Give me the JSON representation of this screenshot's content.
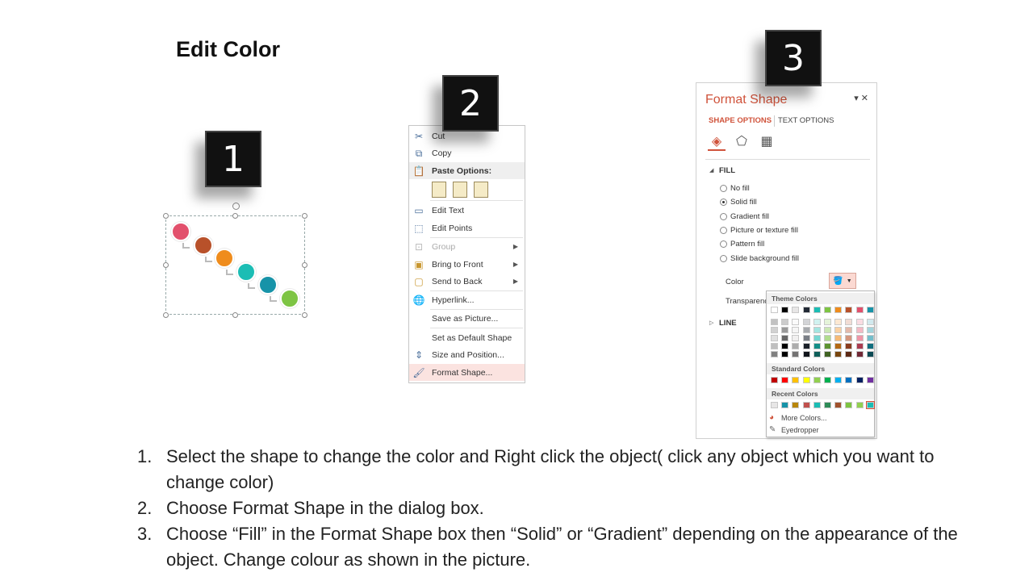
{
  "title": "Edit Color",
  "badges": [
    "1",
    "2",
    "3"
  ],
  "step1_shapes": {
    "colors": [
      "#e2506c",
      "#b8512a",
      "#ef8c1c",
      "#1bbdb4",
      "#1793a8",
      "#7dc443"
    ]
  },
  "context_menu": {
    "items": [
      {
        "label": "Cut",
        "icon": "scissors-icon"
      },
      {
        "label": "Copy",
        "icon": "copy-icon"
      },
      {
        "label": "Paste Options:",
        "icon": "paste-icon"
      },
      {
        "label": "Edit Text",
        "icon": "edit-text-icon"
      },
      {
        "label": "Edit Points",
        "icon": "edit-points-icon"
      },
      {
        "label": "Group",
        "icon": "group-icon"
      },
      {
        "label": "Bring to Front",
        "icon": "bring-front-icon"
      },
      {
        "label": "Send to Back",
        "icon": "send-back-icon"
      },
      {
        "label": "Hyperlink...",
        "icon": "hyperlink-icon"
      },
      {
        "label": "Save as Picture...",
        "icon": ""
      },
      {
        "label": "Set as Default Shape",
        "icon": ""
      },
      {
        "label": "Size and Position...",
        "icon": "size-position-icon"
      },
      {
        "label": "Format Shape...",
        "icon": "format-shape-icon"
      }
    ]
  },
  "format_pane": {
    "title": "Format Shape",
    "controls": "▾ ✕",
    "tab_shape": "SHAPE OPTIONS",
    "tab_text": "TEXT OPTIONS",
    "fill_section": "FILL",
    "fill_options": [
      "No fill",
      "Solid fill",
      "Gradient fill",
      "Picture or texture fill",
      "Pattern fill",
      "Slide background fill"
    ],
    "selected_fill": "Solid fill",
    "color_label": "Color",
    "transparency_label": "Transparenc",
    "line_section": "LINE",
    "accent_color": "#d0533b"
  },
  "palette": {
    "theme_header": "Theme Colors",
    "standard_header": "Standard Colors",
    "recent_header": "Recent Colors",
    "more_colors": "More Colors...",
    "eyedropper": "Eyedropper",
    "theme_top": [
      "#ffffff",
      "#000000",
      "#e7e6e6",
      "#222a35",
      "#1bbdb4",
      "#7dc443",
      "#ef8c1c",
      "#b8512a",
      "#e2506c",
      "#1793a8"
    ],
    "standard": [
      "#c00000",
      "#ff0000",
      "#ffc000",
      "#ffff00",
      "#92d050",
      "#00b050",
      "#00b0f0",
      "#0070c0",
      "#002060",
      "#7030a0"
    ],
    "recent": [
      "#e7e6e6",
      "#1793a8",
      "#b8860b",
      "#c0504d",
      "#1bbdb4",
      "#2e8b57",
      "#a0522d",
      "#7dc443",
      "#92d050",
      "#1bbdb4"
    ]
  },
  "instructions": [
    {
      "num": "1.",
      "text": "Select the shape to change the color and Right click the object( click any object which you want to change color)"
    },
    {
      "num": "2.",
      "text": "Choose Format Shape in the dialog box."
    },
    {
      "num": "3.",
      "text": "Choose “Fill” in the Format Shape box then “Solid” or “Gradient” depending on the appearance of the object. Change colour as shown in the picture."
    }
  ]
}
